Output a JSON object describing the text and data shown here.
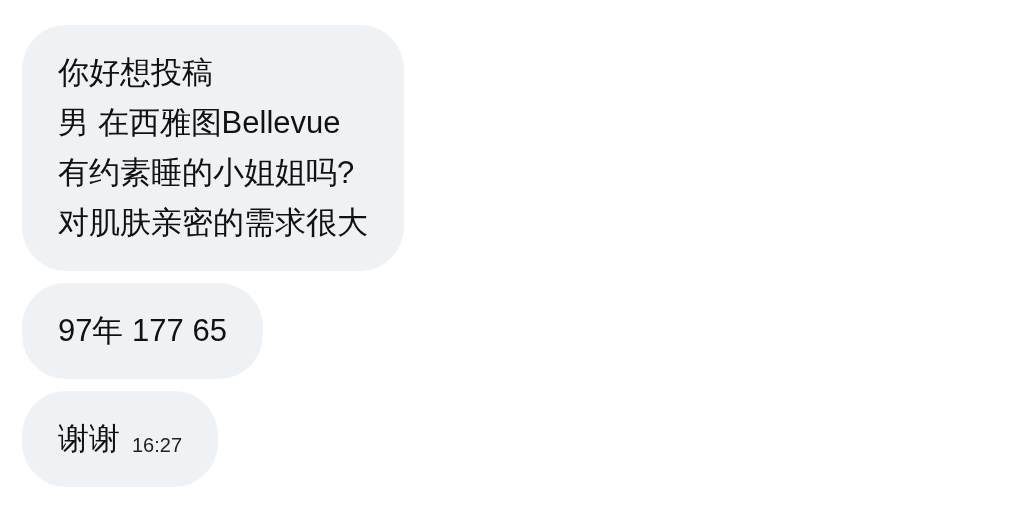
{
  "messages": [
    {
      "lines": [
        "你好想投稿",
        "男 在西雅图Bellevue",
        "有约素睡的小姐姐吗?",
        "对肌肤亲密的需求很大"
      ]
    },
    {
      "lines": [
        "97年 177 65"
      ]
    },
    {
      "lines": [
        "谢谢"
      ],
      "time": "16:27"
    }
  ]
}
